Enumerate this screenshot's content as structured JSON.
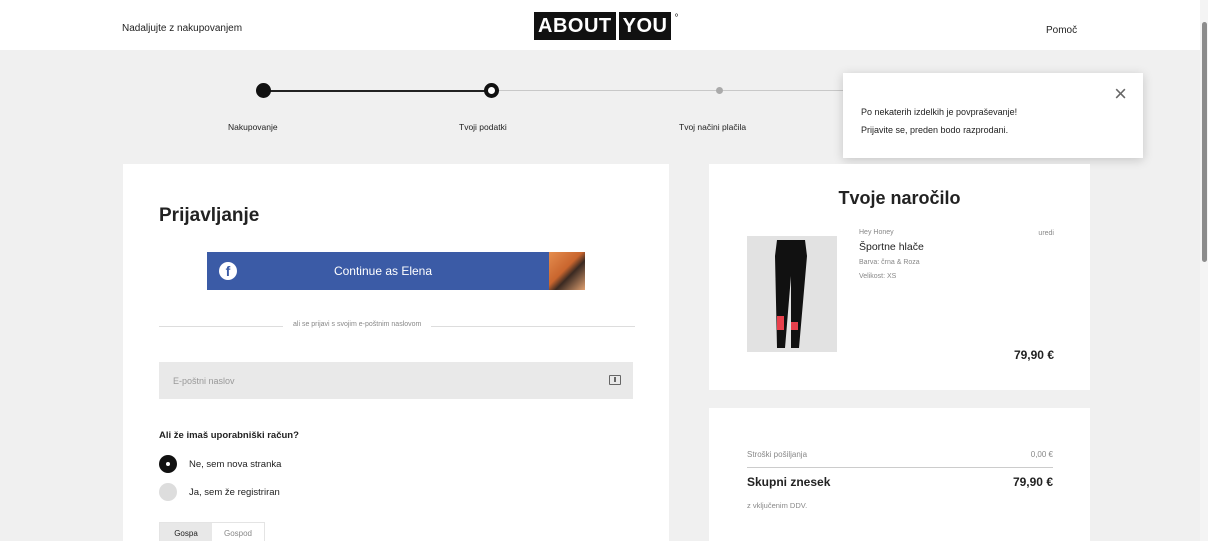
{
  "header": {
    "back_label": "Nadaljujte z nakupovanjem",
    "logo_left": "ABOUT",
    "logo_right": "YOU",
    "logo_mark": "°",
    "help_label": "Pomoč"
  },
  "stepper": {
    "steps": [
      {
        "label": "Nakupovanje",
        "state": "done"
      },
      {
        "label": "Tvoji podatki",
        "state": "current"
      },
      {
        "label": "Tvoj načini plačila",
        "state": "upcoming"
      },
      {
        "state": "upcoming"
      }
    ]
  },
  "toast": {
    "line1": "Po nekaterih izdelkih je povpraševanje!",
    "line2": "Prijavite se, preden bodo razprodani.",
    "close_icon": "close-icon"
  },
  "login": {
    "title": "Prijavljanje",
    "facebook_button": "Continue as Elena",
    "divider_text": "ali se prijavi s svojim e-poštnim naslovom",
    "email_placeholder": "E-poštni naslov",
    "email_value": "",
    "question": "Ali že imaš uporabniški račun?",
    "options": [
      {
        "label": "Ne, sem nova stranka",
        "selected": true
      },
      {
        "label": "Ja, sem že registriran",
        "selected": false
      }
    ],
    "gender": {
      "option1": "Gospa",
      "option2": "Gospod"
    }
  },
  "order": {
    "title": "Tvoje naročilo",
    "item": {
      "brand": "Hey Honey",
      "name": "Športne hlače",
      "color": "Barva: črna & Roza",
      "size": "Velikost: XS",
      "price": "79,90 €",
      "edit": "uredi"
    }
  },
  "summary": {
    "shipping_label": "Stroški pošiljanja",
    "shipping_value": "0,00 €",
    "total_label": "Skupni znesek",
    "total_value": "79,90 €",
    "vat_note": "z vključenim DDV."
  },
  "colors": {
    "brand_black": "#111111",
    "facebook_blue": "#3b5ba6",
    "background": "#f0f0f0",
    "accent_pink": "#e8404c"
  }
}
